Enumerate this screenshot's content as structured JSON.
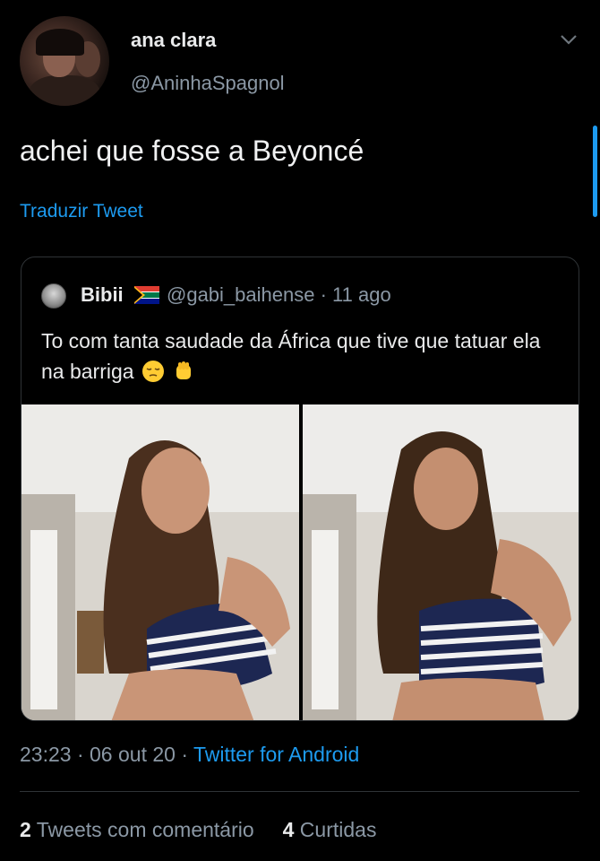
{
  "author": {
    "name": "ana clara",
    "handle": "@AninhaSpagnol"
  },
  "tweet": {
    "text": "achei que fosse a Beyoncé",
    "translate_label": "Traduzir Tweet"
  },
  "quoted": {
    "name": "Bibii",
    "handle": "@gabi_baihense",
    "separator": " · ",
    "date": "11 ago",
    "text": "To com tanta saudade da África que tive que tatuar ela na barriga",
    "emojis": [
      "relieved-face",
      "raised-fist"
    ],
    "media_count": 2
  },
  "footer": {
    "time": "23:23",
    "sep1": " · ",
    "date": "06 out 20",
    "sep2": " · ",
    "source": "Twitter for Android",
    "retweet_count": "2",
    "retweet_label": " Tweets com comentário",
    "like_count": "4",
    "like_label": " Curtidas"
  },
  "colors": {
    "background": "#000000",
    "link": "#1d9bf0",
    "secondary_text": "#8b98a5",
    "border": "#2f3336"
  }
}
